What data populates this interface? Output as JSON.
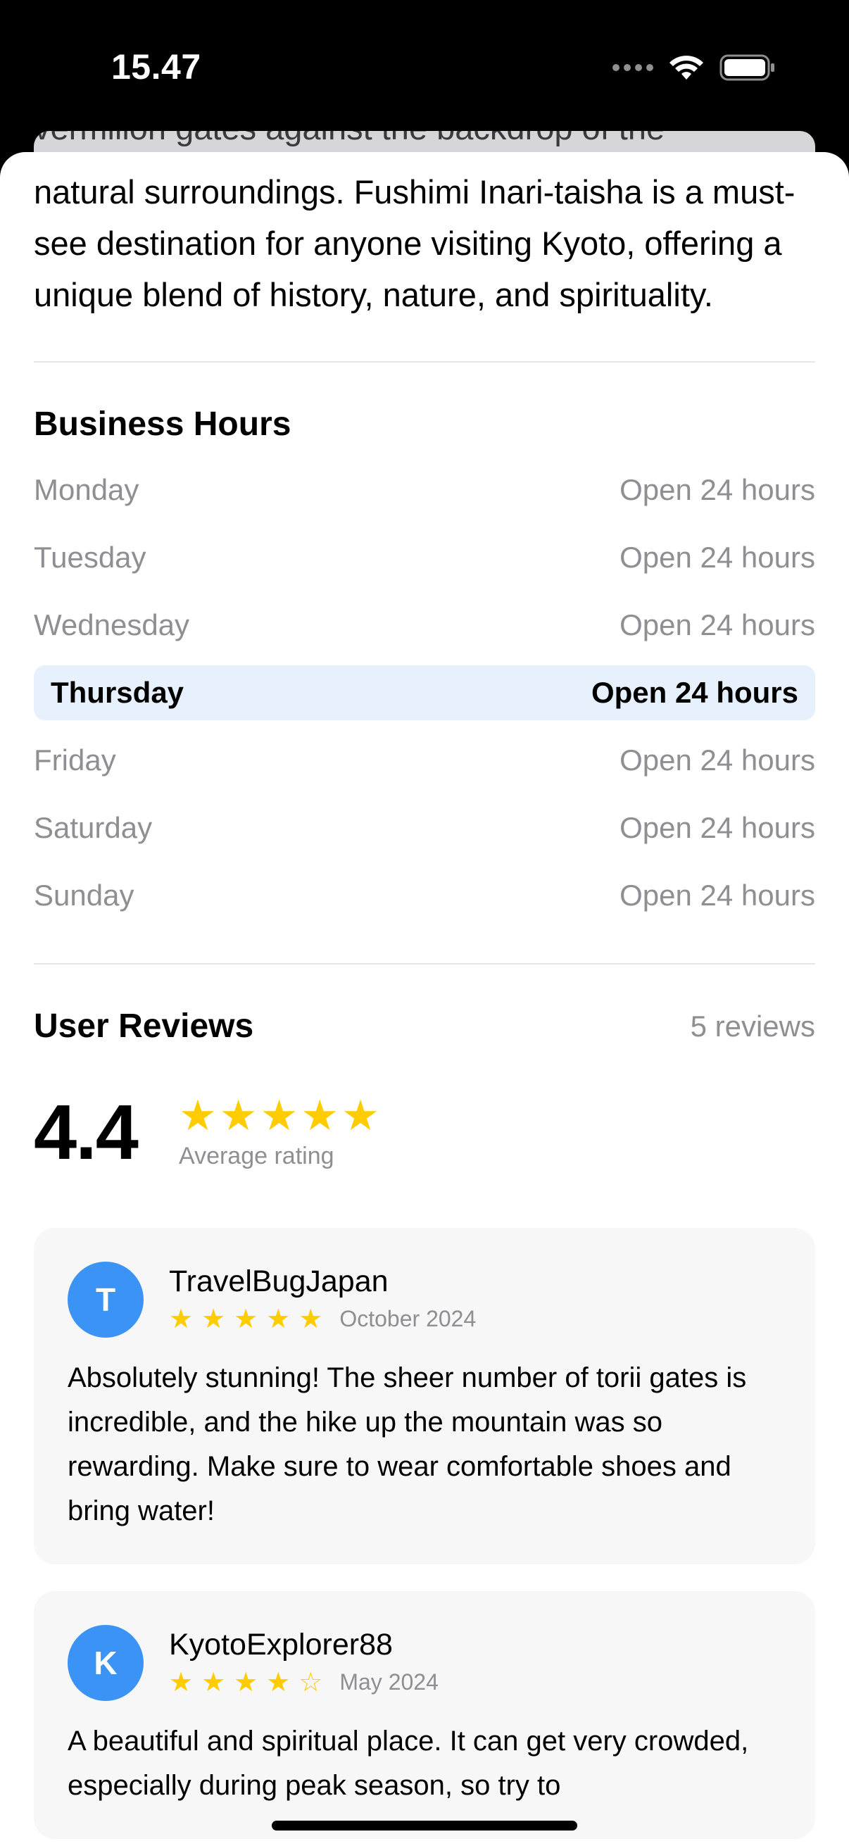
{
  "status_bar": {
    "time": "15.47"
  },
  "background_card": {
    "partial_text": "vermilion gates against the backdrop of the"
  },
  "description": "natural surroundings. Fushimi Inari-taisha is a must-see destination for anyone visiting Kyoto, offering a unique blend of history, nature, and spirituality.",
  "business_hours": {
    "title": "Business Hours",
    "rows": [
      {
        "day": "Monday",
        "hours": "Open 24 hours"
      },
      {
        "day": "Tuesday",
        "hours": "Open 24 hours"
      },
      {
        "day": "Wednesday",
        "hours": "Open 24 hours"
      },
      {
        "day": "Thursday",
        "hours": "Open 24 hours"
      },
      {
        "day": "Friday",
        "hours": "Open 24 hours"
      },
      {
        "day": "Saturday",
        "hours": "Open 24 hours"
      },
      {
        "day": "Sunday",
        "hours": "Open 24 hours"
      }
    ]
  },
  "reviews": {
    "title": "User Reviews",
    "count": "5 reviews",
    "average": "4.4",
    "average_stars": "★★★★★",
    "average_label": "Average rating",
    "items": [
      {
        "initial": "T",
        "name": "TravelBugJapan",
        "stars": "★★★★★",
        "rating": 5,
        "date": "October 2024",
        "text": "Absolutely stunning! The sheer number of torii gates is incredible, and the hike up the mountain was so rewarding. Make sure to wear comfortable shoes and bring water!"
      },
      {
        "initial": "K",
        "name": "KyotoExplorer88",
        "stars": "★★★★☆",
        "rating": 4,
        "date": "May 2024",
        "text": "A beautiful and spiritual place. It can get very crowded, especially during peak season, so try to"
      }
    ]
  },
  "colors": {
    "accent": "#3b94f5",
    "star": "#ffcc00",
    "secondary_text": "#8e8e93",
    "highlight": "#e6f1fd"
  }
}
